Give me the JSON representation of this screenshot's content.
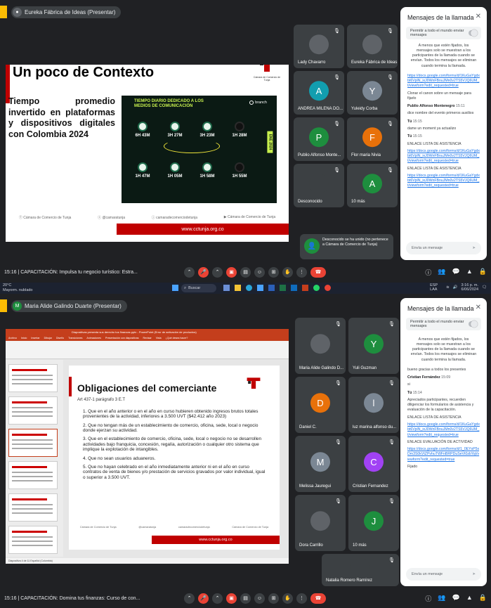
{
  "shot1": {
    "presenter_label": "Eureka Fábrica de Ideas (Presentar)",
    "slide": {
      "title": "Un poco de Contexto",
      "body": "Tiempo promedio invertido en plataformas y dispositivos digitales con Colombia 2024",
      "logo_caption": "Cámara de Comercio de Tunja",
      "infographic": {
        "heading": "TIEMPO DIARIO DEDICADO A LOS MEDIOS DE COMUNICACIÓN",
        "brand": "branch",
        "side_label": "ENE 2024",
        "stats": [
          "6H 43M",
          "3H 27M",
          "3H 23M",
          "1H 28M",
          "1H 47M",
          "1H 05M",
          "1H 58M",
          "1H 55M"
        ]
      },
      "footer_items": [
        "Cámara de Comercio de Tunja",
        "@camaratunja",
        "camaradecomerciodetunja",
        "Cámara de Comercio de Tunja"
      ],
      "url": "www.cctunja.org.co"
    },
    "participants": [
      {
        "name": "Lady Chavarro",
        "initial": "",
        "color": "#5f6368"
      },
      {
        "name": "Eureka Fábrica de Ideas",
        "initial": "",
        "color": "#5f6368"
      },
      {
        "name": "ANDREA MILENA DO...",
        "initial": "A",
        "color": "#129eaf"
      },
      {
        "name": "Yuleidy Corba",
        "initial": "Y",
        "color": "#7b8794"
      },
      {
        "name": "Publio Alfonso Monte...",
        "initial": "P",
        "color": "#1e8e3e"
      },
      {
        "name": "Flor maria Nivia",
        "initial": "F",
        "color": "#e8710a"
      },
      {
        "name": "Desconocido",
        "initial": "",
        "color": "#3c4043"
      },
      {
        "name": "10 más",
        "initial": "A",
        "color": "#1e8e3e"
      }
    ],
    "join_toast": "Desconocido se ha unido (no pertenece a Cámara de Comercio de Tunja)",
    "chat": {
      "title": "Mensajes de la llamada",
      "toggle_label": "Permitir a todo el mundo enviar mensajes",
      "notice": "A menos que estén fijados, los mensajes solo se muestran a los participantes de la llamada cuando se envían. Todos los mensajes se eliminan cuando termina la llamada.",
      "messages": [
        {
          "sender": "",
          "time": "",
          "text": "https://docs.google.com/forms/d/1KuGaYgdxbt6VplN_ixJ0WnFBnuJMn0v2TS5VJQ6UM_t/viewform?edit_requested=true",
          "link": true
        },
        {
          "sender": "",
          "time": "",
          "text": "Clonar el canon sobre un mensaje para fijarlo",
          "link": false
        },
        {
          "sender": "Publio Alfonso Montenegro",
          "time": "15:11",
          "text": "dice nombre del evento primeros auxilios",
          "link": false
        },
        {
          "sender": "Tú",
          "time": "15:15",
          "text": "dame un moment ya actualizo",
          "link": false
        },
        {
          "sender": "Tú",
          "time": "15:15",
          "text": "ENLACE LISTA DE ASISTENCIA",
          "link": false
        },
        {
          "sender": "",
          "time": "",
          "text": "https://docs.google.com/forms/d/1KuGaYgdxbt6VplN_ixJ0WnFBnuJMn0v2TS5VJQ6UM_t/viewform?edit_requested=true",
          "link": true
        },
        {
          "sender": "",
          "time": "",
          "text": "ENLACE LISTA DE ASISTENCIA",
          "link": false
        },
        {
          "sender": "",
          "time": "",
          "text": "https://docs.google.com/forms/d/1KuGaYgdxbt6VplN_ixJ0WnFBnuJMn0v2TS5VJQ6UM_t/viewform?edit_requested=true",
          "link": true
        }
      ],
      "input_placeholder": "Envía un mensaje"
    },
    "bottom": {
      "time": "15:16",
      "meeting": "CAPACITACIÓN: Impulsa tu negocio turístico: Estra..."
    }
  },
  "shot2": {
    "taskbar": {
      "weather_temp": "20°C",
      "weather_desc": "Mayorm. nublado",
      "search": "Buscar",
      "lang": "ESP LAA",
      "clock_time": "3:16 p. m.",
      "clock_date": "6/06/2024"
    },
    "presenter_label": "Maria Alide Galindo Duarte (Presentar)",
    "ppt": {
      "window_title": "Diapositivas presenta sus derecho tus finanzas.pptx - PowerPoint (Error de activación de productos)",
      "tabs": [
        "Archivo",
        "Inicio",
        "Insertar",
        "Dibujar",
        "Diseño",
        "Transiciones",
        "Animaciones",
        "Presentación con diapositivas",
        "Revisar",
        "Vista",
        "¿Qué desea hacer?"
      ],
      "slide_title": "Obligaciones del comerciante",
      "subtitle": "Art 437-1 parágrafo 3 E.T",
      "items": [
        "1. Que en el año anterior o en el año en curso hubieren obtenido ingresos brutos totales provenientes de la actividad, inferiores a 3.500 UVT ($42.412 año 2023)",
        "2. Que no tengan más de un establecimiento de comercio, oficina, sede, local o negocio donde ejerzan su actividad.",
        "3. Que en el establecimiento de comercio, oficina, sede, local o negocio no se desarrollen actividades bajo franquicia, concesión, regalía, autorización o cualquier otro sistema que implique la explotación de intangibles.",
        "4. Que no sean usuarios aduaneros.",
        "5. Que no hayan celebrado en el año inmediatamente anterior ni en el año en curso contratos de venta de bienes y/o prestación de servicios gravados por valor individual, igual o superior a 3.500 UVT."
      ],
      "footer_items": [
        "Cámara de Comercio de Tunja",
        "@camaratunja",
        "camaradecomerciodetunja",
        "Cámara de Comercio de Tunja"
      ],
      "url": "www.cctunja.org.co",
      "status": "Diapositiva 4 de 11   Español (Colombia)"
    },
    "participants": [
      {
        "name": "Maria Alide Galindo D...",
        "initial": "",
        "color": "#5f6368"
      },
      {
        "name": "Yuli Guzman",
        "initial": "Y",
        "color": "#1e8e3e"
      },
      {
        "name": "Daniel C.",
        "initial": "D",
        "color": "#e8710a"
      },
      {
        "name": "luz marina alfonso du...",
        "initial": "l",
        "color": "#7b8794"
      },
      {
        "name": "Melissa Jauregui",
        "initial": "M",
        "color": "#7b8794"
      },
      {
        "name": "Cristian Fernandez",
        "initial": "C",
        "color": "#a142f4"
      },
      {
        "name": "Dora Carrillo",
        "initial": "",
        "color": "#5f6368"
      },
      {
        "name": "10 más",
        "initial": "J",
        "color": "#1e8e3e"
      },
      {
        "name": "Natalia Romero Ramírez",
        "initial": "",
        "color": "#3c4043"
      }
    ],
    "chat": {
      "title": "Mensajes de la llamada",
      "toggle_label": "Permitir a todo el mundo enviar mensajes",
      "notice": "A menos que estén fijados, los mensajes solo se muestran a los participantes de la llamada cuando se envían. Todos los mensajes se eliminan cuando termina la llamada.",
      "messages": [
        {
          "sender": "",
          "time": "",
          "text": "bueno gracias a todos los presentes",
          "link": false
        },
        {
          "sender": "Cristian Fernández",
          "time": "15:09",
          "text": "si",
          "link": false
        },
        {
          "sender": "Tú",
          "time": "15:14",
          "text": "Apreciados participantes, recuerden diligenciar los formularios de asistencia y evaluación de la capacitación.",
          "link": false
        },
        {
          "sender": "",
          "time": "",
          "text": "ENLACE LISTA DE ASISTENCIA",
          "link": false
        },
        {
          "sender": "",
          "time": "",
          "text": "https://docs.google.com/forms/d/1KuGaYgdxbt6VplN_ixJ0WnFBnuJMn0v2TS5VJQ6UM_t/viewform?edit_requested=true",
          "link": true
        },
        {
          "sender": "",
          "time": "",
          "text": "ENLACE EVALUACIÓN DE ACTIVIDAD",
          "link": false
        },
        {
          "sender": "",
          "time": "",
          "text": "https://docs.google.com/forms/d/1_0EYsP5xDm3S0kVtZPvhuTWFnBRPDuSeVt0zbYqI/viewform?edit_requested=true",
          "link": true
        },
        {
          "sender": "",
          "time": "",
          "text": "Fijado",
          "link": false
        }
      ],
      "input_placeholder": "Envía un mensaje"
    },
    "bottom": {
      "time": "15:16",
      "meeting": "CAPACITACIÓN: Domina tus finanzas: Curso de con..."
    }
  },
  "colors": {
    "meet_bg": "#202124",
    "red": "#ea4335",
    "link": "#1a73e8",
    "ppt": "#c43e1c",
    "slide_red": "#c00000"
  }
}
